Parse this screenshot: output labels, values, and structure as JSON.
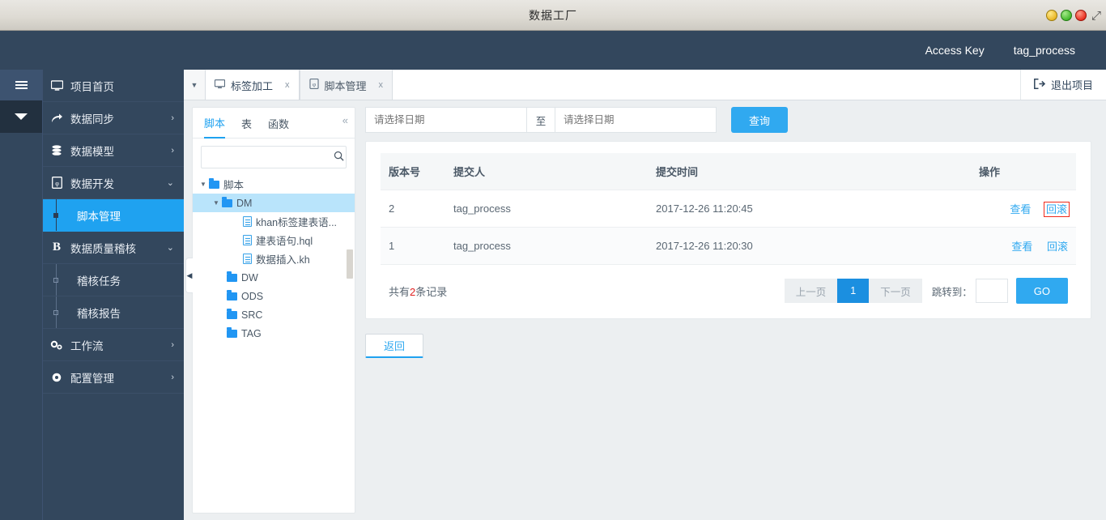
{
  "window": {
    "title": "数据工厂",
    "buttons": [
      {
        "name": "minimize",
        "color": "#e8b321"
      },
      {
        "name": "maximize",
        "color": "#3fb628"
      },
      {
        "name": "close",
        "color": "#e82b1c"
      }
    ],
    "expand_icon": "⤢"
  },
  "topbar": {
    "access_key_label": "Access Key",
    "access_key_value": "tag_process"
  },
  "rail": {
    "menu_icon": "hamburger-icon",
    "collapse_icon": "chevron-down-icon"
  },
  "sidebar": {
    "items": [
      {
        "label": "项目首页",
        "icon": "monitor-icon",
        "arrow": "",
        "active": false,
        "sub": false
      },
      {
        "label": "数据同步",
        "icon": "share-arrow-icon",
        "arrow": "›",
        "active": false,
        "sub": false
      },
      {
        "label": "数据模型",
        "icon": "database-icon",
        "arrow": "›",
        "active": false,
        "sub": false
      },
      {
        "label": "数据开发",
        "icon": "file-code-icon",
        "arrow": "⌄",
        "active": false,
        "sub": false
      },
      {
        "label": "脚本管理",
        "icon": "",
        "arrow": "",
        "active": true,
        "sub": true
      },
      {
        "label": "数据质量稽核",
        "icon": "B",
        "arrow": "⌄",
        "active": false,
        "sub": false
      },
      {
        "label": "稽核任务",
        "icon": "",
        "arrow": "",
        "active": false,
        "sub": true
      },
      {
        "label": "稽核报告",
        "icon": "",
        "arrow": "",
        "active": false,
        "sub": true
      },
      {
        "label": "工作流",
        "icon": "cogs-icon",
        "arrow": "›",
        "active": false,
        "sub": false
      },
      {
        "label": "配置管理",
        "icon": "gear-icon",
        "arrow": "›",
        "active": false,
        "sub": false
      }
    ]
  },
  "tabs": {
    "dropdown_icon": "▼",
    "items": [
      {
        "label": "标签加工",
        "icon": "monitor-icon",
        "close": "x",
        "active": true
      },
      {
        "label": "脚本管理",
        "icon": "file-code-icon",
        "close": "x",
        "active": false
      }
    ],
    "exit_project": {
      "label": "退出项目",
      "icon": "exit-icon"
    }
  },
  "tree_panel": {
    "tabs": [
      {
        "label": "脚本",
        "active": true
      },
      {
        "label": "表",
        "active": false
      },
      {
        "label": "函数",
        "active": false
      }
    ],
    "collapse_icon": "«",
    "search": {
      "value": "",
      "placeholder": "",
      "icon": "search-icon"
    },
    "nodes": [
      {
        "label": "脚本",
        "type": "folder",
        "indent": 0,
        "caret": "▼",
        "selected": false
      },
      {
        "label": "DM",
        "type": "folder",
        "indent": 1,
        "caret": "▼",
        "selected": true
      },
      {
        "label": "khan标签建表语...",
        "type": "file",
        "indent": 2,
        "caret": "",
        "selected": false
      },
      {
        "label": "建表语句.hql",
        "type": "file",
        "indent": 2,
        "caret": "",
        "selected": false
      },
      {
        "label": "数据插入.kh",
        "type": "file",
        "indent": 2,
        "caret": "",
        "selected": false
      },
      {
        "label": "DW",
        "type": "folder",
        "indent": 1,
        "caret": "",
        "selected": false
      },
      {
        "label": "ODS",
        "type": "folder",
        "indent": 1,
        "caret": "",
        "selected": false
      },
      {
        "label": "SRC",
        "type": "folder",
        "indent": 1,
        "caret": "",
        "selected": false
      },
      {
        "label": "TAG",
        "type": "folder",
        "indent": 1,
        "caret": "",
        "selected": false
      }
    ]
  },
  "filter": {
    "date_from": {
      "value": "",
      "placeholder": "请选择日期"
    },
    "separator": "至",
    "date_to": {
      "value": "",
      "placeholder": "请选择日期"
    },
    "query_button": "查询"
  },
  "table": {
    "headers": [
      "版本号",
      "提交人",
      "提交时间",
      "操作"
    ],
    "rows": [
      {
        "version": "2",
        "submitter": "tag_process",
        "time": "2017-12-26 11:20:45",
        "view": "查看",
        "rollback": "回滚",
        "highlight": true
      },
      {
        "version": "1",
        "submitter": "tag_process",
        "time": "2017-12-26 11:20:30",
        "view": "查看",
        "rollback": "回滚",
        "highlight": false
      }
    ]
  },
  "pagination": {
    "total_prefix": "共有",
    "total_count": "2",
    "total_suffix": "条记录",
    "prev": "上一页",
    "current": "1",
    "next": "下一页",
    "jump_label": "跳转到：",
    "jump_value": "",
    "go": "GO"
  },
  "footer": {
    "back_button": "返回"
  },
  "colors": {
    "header_blue": "#33475d",
    "accent_blue": "#30a9f0",
    "active_nav": "#1fa2f0",
    "annotation_red": "#ef2b1c",
    "page_bg": "#eceff1"
  }
}
